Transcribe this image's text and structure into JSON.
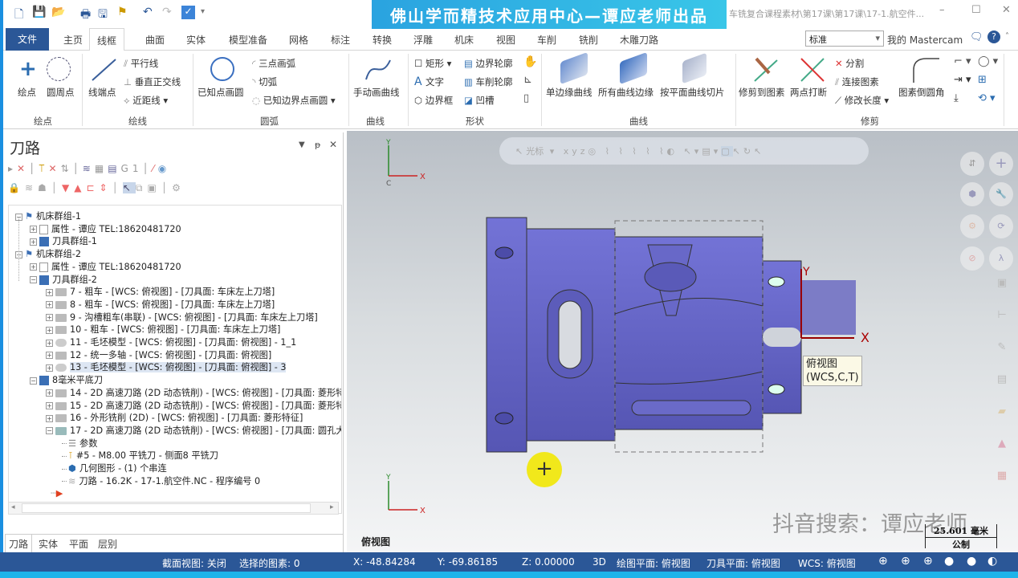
{
  "banner": "佛山学而精技术应用中心—谭应老师出品",
  "window_title": "车铣复合课程素材\\第17课\\第17课\\17-1.航空件...",
  "tabs": [
    "文件",
    "主页",
    "线框",
    "曲面",
    "实体",
    "模型准备",
    "网格",
    "标注",
    "转换",
    "浮雕",
    "机床",
    "视图",
    "车削",
    "铣削",
    "木雕刀路"
  ],
  "active_tab": "线框",
  "style_combo": "标准",
  "my_mastercam": "我的 Mastercam",
  "ribbon": {
    "points": {
      "a": "绘点",
      "b": "圆周点",
      "group": "绘点"
    },
    "lines": {
      "a": "线端点",
      "b": "平行线",
      "c": "垂直正交线",
      "d": "近距线",
      "group": "绘线"
    },
    "arcs": {
      "a": "已知点画圆",
      "b": "三点画弧",
      "c": "切弧",
      "d": "已知边界点画圆",
      "group": "圆弧"
    },
    "curve1": {
      "a": "手动画曲线",
      "group": "曲线"
    },
    "shapes": {
      "a": "矩形",
      "b": "文字",
      "c": "边界框",
      "d": "边界轮廓",
      "e": "车削轮廓",
      "f": "凹槽",
      "group": "形状"
    },
    "curves": {
      "a": "单边缘曲线",
      "b": "所有曲线边缘",
      "c": "按平面曲线切片",
      "group": "曲线"
    },
    "trim": {
      "a": "修剪到图素",
      "b": "两点打断",
      "c": "分割",
      "d": "连接图素",
      "e": "修改长度",
      "f": "图素倒圆角",
      "group": "修剪"
    }
  },
  "panel": {
    "title": "刀路",
    "tree": [
      {
        "level": 0,
        "text": "机床群组-1",
        "icon": "machine"
      },
      {
        "level": 1,
        "text": "属性 - 谭应 TEL:18620481720",
        "icon": "props"
      },
      {
        "level": 1,
        "text": "刀具群组-1",
        "icon": "grid"
      },
      {
        "level": 0,
        "text": "机床群组-2",
        "icon": "machine"
      },
      {
        "level": 1,
        "text": "属性 - 谭应 TEL:18620481720",
        "icon": "props"
      },
      {
        "level": 1,
        "text": "刀具群组-2",
        "icon": "grid"
      },
      {
        "level": 2,
        "text": "7 - 粗车 - [WCS: 俯视图] - [刀具面: 车床左上刀塔]",
        "icon": "folder"
      },
      {
        "level": 2,
        "text": "8 - 粗车 - [WCS: 俯视图] - [刀具面: 车床左上刀塔]",
        "icon": "folder"
      },
      {
        "level": 2,
        "text": "9 - 沟槽粗车(串联) - [WCS: 俯视图] - [刀具面: 车床左上刀塔]",
        "icon": "folder"
      },
      {
        "level": 2,
        "text": "10 - 粗车 - [WCS: 俯视图] - [刀具面: 车床左上刀塔]",
        "icon": "folder"
      },
      {
        "level": 2,
        "text": "11 - 毛坯模型 - [WCS: 俯视图] - [刀具面: 俯视图] - 1_1",
        "icon": "stock"
      },
      {
        "level": 2,
        "text": "12 - 统一多轴 - [WCS: 俯视图] - [刀具面: 俯视图]",
        "icon": "folder"
      },
      {
        "level": 2,
        "text": "13 - 毛坯模型 - [WCS: 俯视图] - [刀具面: 俯视图] - 3",
        "icon": "stock",
        "selected": true
      },
      {
        "level": 1,
        "text": "8毫米平底刀",
        "icon": "grid"
      },
      {
        "level": 2,
        "text": "14 - 2D 高速刀路 (2D 动态铣削) - [WCS: 俯视图] - [刀具面: 菱形特",
        "icon": "folder"
      },
      {
        "level": 2,
        "text": "15 - 2D 高速刀路 (2D 动态铣削) - [WCS: 俯视图] - [刀具面: 菱形特",
        "icon": "folder"
      },
      {
        "level": 2,
        "text": "16 - 外形铣削 (2D) - [WCS: 俯视图] - [刀具面: 菱形特征]",
        "icon": "folder"
      },
      {
        "level": 2,
        "text": "17 - 2D 高速刀路 (2D 动态铣削) - [WCS: 俯视图] - [刀具面: 圆孔大",
        "icon": "folder-open"
      },
      {
        "level": 3,
        "text": "参数",
        "icon": "params"
      },
      {
        "level": 3,
        "text": "#5 - M8.00 平铣刀 - 侧面8 平铣刀",
        "icon": "tool"
      },
      {
        "level": 3,
        "text": "几何图形 - (1) 个串连",
        "icon": "geometry"
      },
      {
        "level": 3,
        "text": "刀路 - 16.2K - 17-1.航空件.NC - 程序编号 0",
        "icon": "toolpath"
      }
    ],
    "bottom_tabs": [
      "刀路",
      "实体",
      "平面",
      "层别"
    ]
  },
  "viewport": {
    "toolbar_cursor": "光标",
    "view_label": "俯视图",
    "tooltip_line1": "俯视图",
    "tooltip_line2": "(WCS,C,T)",
    "watermark": "抖音搜索：谭应老师",
    "scale_value": "25.601 毫米",
    "scale_unit": "公制",
    "axis_x": "X",
    "axis_y": "Y",
    "axis_c": "C",
    "axis_t": "T"
  },
  "status": {
    "section": "截面视图: 关闭",
    "selected": "选择的图素: 0",
    "x": "X:   -48.84284",
    "y": "Y:   -69.86185",
    "z": "Z:   0.00000",
    "mode": "3D",
    "cplane": "绘图平面: 俯视图",
    "tplane": "刀具平面: 俯视图",
    "wcs": "WCS: 俯视图"
  },
  "colors": {
    "accent": "#2b5797",
    "part": "#6f6fd0",
    "banner": "#2aa3e0"
  }
}
